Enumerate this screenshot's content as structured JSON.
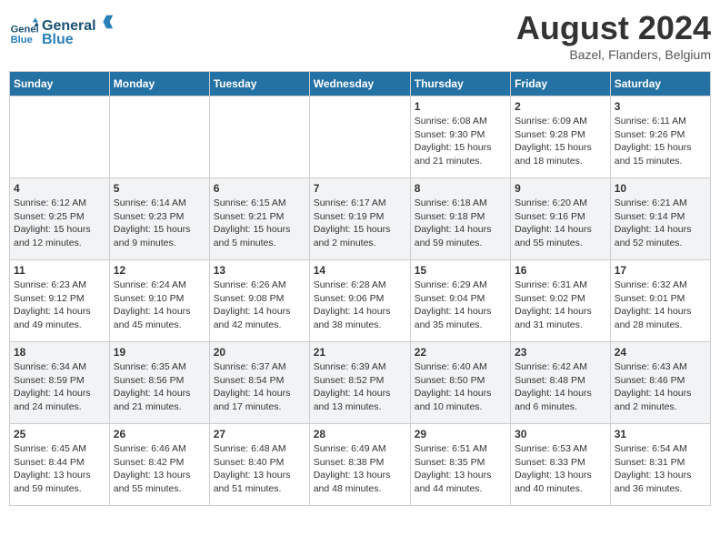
{
  "header": {
    "logo_line1": "General",
    "logo_line2": "Blue",
    "month_title": "August 2024",
    "location": "Bazel, Flanders, Belgium"
  },
  "days_of_week": [
    "Sunday",
    "Monday",
    "Tuesday",
    "Wednesday",
    "Thursday",
    "Friday",
    "Saturday"
  ],
  "weeks": [
    [
      {
        "day": "",
        "detail": ""
      },
      {
        "day": "",
        "detail": ""
      },
      {
        "day": "",
        "detail": ""
      },
      {
        "day": "",
        "detail": ""
      },
      {
        "day": "1",
        "detail": "Sunrise: 6:08 AM\nSunset: 9:30 PM\nDaylight: 15 hours and 21 minutes."
      },
      {
        "day": "2",
        "detail": "Sunrise: 6:09 AM\nSunset: 9:28 PM\nDaylight: 15 hours and 18 minutes."
      },
      {
        "day": "3",
        "detail": "Sunrise: 6:11 AM\nSunset: 9:26 PM\nDaylight: 15 hours and 15 minutes."
      }
    ],
    [
      {
        "day": "4",
        "detail": "Sunrise: 6:12 AM\nSunset: 9:25 PM\nDaylight: 15 hours and 12 minutes."
      },
      {
        "day": "5",
        "detail": "Sunrise: 6:14 AM\nSunset: 9:23 PM\nDaylight: 15 hours and 9 minutes."
      },
      {
        "day": "6",
        "detail": "Sunrise: 6:15 AM\nSunset: 9:21 PM\nDaylight: 15 hours and 5 minutes."
      },
      {
        "day": "7",
        "detail": "Sunrise: 6:17 AM\nSunset: 9:19 PM\nDaylight: 15 hours and 2 minutes."
      },
      {
        "day": "8",
        "detail": "Sunrise: 6:18 AM\nSunset: 9:18 PM\nDaylight: 14 hours and 59 minutes."
      },
      {
        "day": "9",
        "detail": "Sunrise: 6:20 AM\nSunset: 9:16 PM\nDaylight: 14 hours and 55 minutes."
      },
      {
        "day": "10",
        "detail": "Sunrise: 6:21 AM\nSunset: 9:14 PM\nDaylight: 14 hours and 52 minutes."
      }
    ],
    [
      {
        "day": "11",
        "detail": "Sunrise: 6:23 AM\nSunset: 9:12 PM\nDaylight: 14 hours and 49 minutes."
      },
      {
        "day": "12",
        "detail": "Sunrise: 6:24 AM\nSunset: 9:10 PM\nDaylight: 14 hours and 45 minutes."
      },
      {
        "day": "13",
        "detail": "Sunrise: 6:26 AM\nSunset: 9:08 PM\nDaylight: 14 hours and 42 minutes."
      },
      {
        "day": "14",
        "detail": "Sunrise: 6:28 AM\nSunset: 9:06 PM\nDaylight: 14 hours and 38 minutes."
      },
      {
        "day": "15",
        "detail": "Sunrise: 6:29 AM\nSunset: 9:04 PM\nDaylight: 14 hours and 35 minutes."
      },
      {
        "day": "16",
        "detail": "Sunrise: 6:31 AM\nSunset: 9:02 PM\nDaylight: 14 hours and 31 minutes."
      },
      {
        "day": "17",
        "detail": "Sunrise: 6:32 AM\nSunset: 9:01 PM\nDaylight: 14 hours and 28 minutes."
      }
    ],
    [
      {
        "day": "18",
        "detail": "Sunrise: 6:34 AM\nSunset: 8:59 PM\nDaylight: 14 hours and 24 minutes."
      },
      {
        "day": "19",
        "detail": "Sunrise: 6:35 AM\nSunset: 8:56 PM\nDaylight: 14 hours and 21 minutes."
      },
      {
        "day": "20",
        "detail": "Sunrise: 6:37 AM\nSunset: 8:54 PM\nDaylight: 14 hours and 17 minutes."
      },
      {
        "day": "21",
        "detail": "Sunrise: 6:39 AM\nSunset: 8:52 PM\nDaylight: 14 hours and 13 minutes."
      },
      {
        "day": "22",
        "detail": "Sunrise: 6:40 AM\nSunset: 8:50 PM\nDaylight: 14 hours and 10 minutes."
      },
      {
        "day": "23",
        "detail": "Sunrise: 6:42 AM\nSunset: 8:48 PM\nDaylight: 14 hours and 6 minutes."
      },
      {
        "day": "24",
        "detail": "Sunrise: 6:43 AM\nSunset: 8:46 PM\nDaylight: 14 hours and 2 minutes."
      }
    ],
    [
      {
        "day": "25",
        "detail": "Sunrise: 6:45 AM\nSunset: 8:44 PM\nDaylight: 13 hours and 59 minutes."
      },
      {
        "day": "26",
        "detail": "Sunrise: 6:46 AM\nSunset: 8:42 PM\nDaylight: 13 hours and 55 minutes."
      },
      {
        "day": "27",
        "detail": "Sunrise: 6:48 AM\nSunset: 8:40 PM\nDaylight: 13 hours and 51 minutes."
      },
      {
        "day": "28",
        "detail": "Sunrise: 6:49 AM\nSunset: 8:38 PM\nDaylight: 13 hours and 48 minutes."
      },
      {
        "day": "29",
        "detail": "Sunrise: 6:51 AM\nSunset: 8:35 PM\nDaylight: 13 hours and 44 minutes."
      },
      {
        "day": "30",
        "detail": "Sunrise: 6:53 AM\nSunset: 8:33 PM\nDaylight: 13 hours and 40 minutes."
      },
      {
        "day": "31",
        "detail": "Sunrise: 6:54 AM\nSunset: 8:31 PM\nDaylight: 13 hours and 36 minutes."
      }
    ]
  ]
}
